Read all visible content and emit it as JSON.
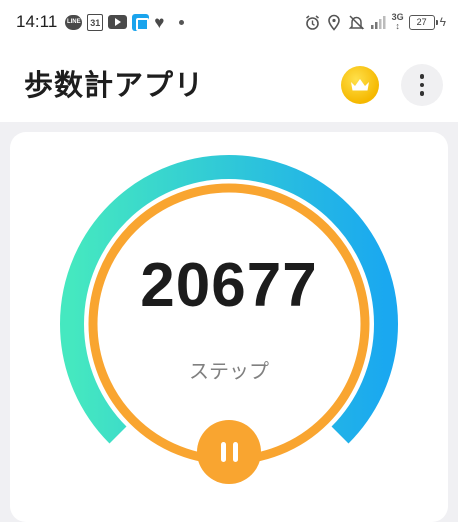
{
  "status_bar": {
    "time": "14:11",
    "calendar_day": "31",
    "line_label": "LINE",
    "network": "3G",
    "battery": "27",
    "left_icons": [
      "line-icon",
      "calendar-icon",
      "youtube-icon",
      "app-icon",
      "heart-icon",
      "dot-icon"
    ],
    "right_icons": [
      "alarm-icon",
      "location-icon",
      "bell-muted-icon",
      "signal-icon",
      "network-icon",
      "battery-icon",
      "charging-icon"
    ]
  },
  "app_bar": {
    "title": "歩数計アプリ",
    "crown_icon": "crown-icon",
    "menu_icon": "more-vert-icon"
  },
  "gauge": {
    "steps": "20677",
    "unit_label": "ステップ",
    "progress": 0.9,
    "colors": {
      "arc_start": "#45e8c0",
      "arc_end": "#1aa8f0",
      "ring": "#f9a530"
    }
  },
  "controls": {
    "pause_icon": "pause-icon",
    "pause_color": "#f9a530"
  }
}
